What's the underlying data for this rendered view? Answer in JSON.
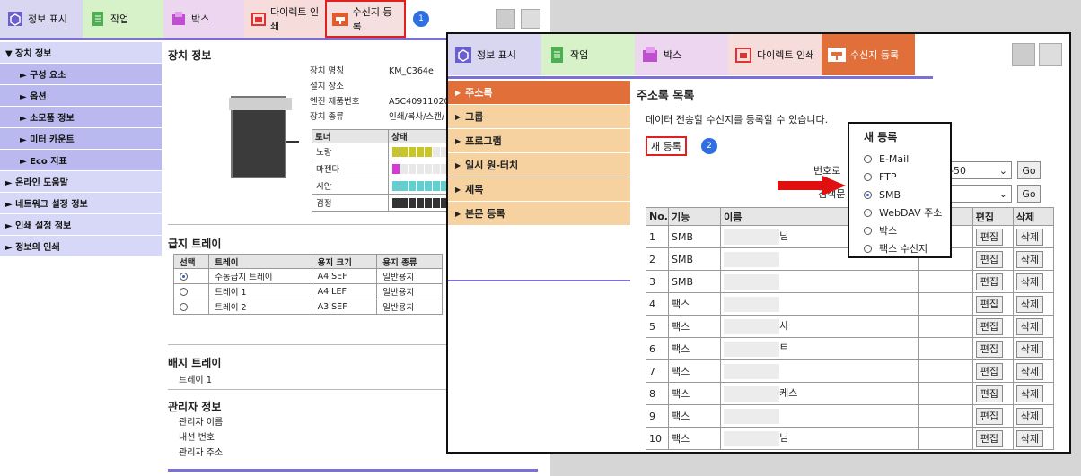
{
  "back": {
    "tabs": [
      "정보 표시",
      "작업",
      "박스",
      "다이렉트 인쇄",
      "수신지 등록"
    ],
    "badge": "1",
    "sidebar": [
      {
        "label": "▼ 장치 정보",
        "level": "top"
      },
      {
        "label": "► 구성 요소",
        "level": "sub"
      },
      {
        "label": "► 옵션",
        "level": "sub"
      },
      {
        "label": "► 소모품 정보",
        "level": "sub"
      },
      {
        "label": "► 미터 카운트",
        "level": "sub"
      },
      {
        "label": "► Eco 지표",
        "level": "sub"
      },
      {
        "label": "► 온라인 도움말",
        "level": "top"
      },
      {
        "label": "► 네트워크 설정 정보",
        "level": "top"
      },
      {
        "label": "► 인쇄 설정 정보",
        "level": "top"
      },
      {
        "label": "► 정보의 인쇄",
        "level": "top"
      }
    ],
    "device_title": "장치 정보",
    "device_info": [
      {
        "k": "장치 명칭",
        "v": "KM_C364e"
      },
      {
        "k": "설치 장소",
        "v": ""
      },
      {
        "k": "엔진 제품번호",
        "v": "A5C4091102013"
      },
      {
        "k": "장치 종류",
        "v": "인쇄/복사/스캔/"
      }
    ],
    "toner": {
      "headers": [
        "토너",
        "상태"
      ],
      "rows": [
        {
          "name": "노랑",
          "color": "#c9c42a",
          "segs": 5
        },
        {
          "name": "마젠다",
          "color": "#d63ad6",
          "segs": 1
        },
        {
          "name": "시안",
          "color": "#5fcfd2",
          "segs": 7
        },
        {
          "name": "검정",
          "color": "#333333",
          "segs": 7
        }
      ]
    },
    "feed_title": "급지 트레이",
    "feed_headers": [
      "선택",
      "트레이",
      "용지 크기",
      "용지 종류"
    ],
    "feed_rows": [
      {
        "selected": true,
        "tray": "수동급지 트레이",
        "size": "A4 SEF",
        "type": "일반용지"
      },
      {
        "selected": false,
        "tray": "트레이 1",
        "size": "A4 LEF",
        "type": "일반용지"
      },
      {
        "selected": false,
        "tray": "트레이 2",
        "size": "A3 SEF",
        "type": "일반용지"
      }
    ],
    "out_title": "배지 트레이",
    "out_item": "트레이 1",
    "admin_title": "관리자 정보",
    "admin_items": [
      "관리자 이름",
      "내선 번호",
      "관리자 주소"
    ]
  },
  "front": {
    "tabs": [
      "정보 표시",
      "작업",
      "박스",
      "다이렉트 인쇄",
      "수신지 등록"
    ],
    "sidebar": [
      "주소록",
      "그룹",
      "프로그램",
      "일시 원-터치",
      "제목",
      "본문 등록"
    ],
    "title": "주소록 목록",
    "desc": "데이터 전송할 수신지를 등록할 수 있습니다.",
    "new_btn": "새 등록",
    "badge": "2",
    "num_label": "번호로",
    "num_select": "-50",
    "search_label": "검색문",
    "go": "Go",
    "headers": [
      "No.",
      "기능",
      "이름",
      "E",
      "편집",
      "삭제"
    ],
    "rows": [
      {
        "no": "1",
        "type": "SMB",
        "name_tail": "님"
      },
      {
        "no": "2",
        "type": "SMB",
        "name_tail": ""
      },
      {
        "no": "3",
        "type": "SMB",
        "name_tail": ""
      },
      {
        "no": "4",
        "type": "팩스",
        "name_tail": ""
      },
      {
        "no": "5",
        "type": "팩스",
        "name_tail": "사"
      },
      {
        "no": "6",
        "type": "팩스",
        "name_tail": "트"
      },
      {
        "no": "7",
        "type": "팩스",
        "name_tail": ""
      },
      {
        "no": "8",
        "type": "팩스",
        "name_tail": "케스"
      },
      {
        "no": "9",
        "type": "팩스",
        "name_tail": ""
      },
      {
        "no": "10",
        "type": "팩스",
        "name_tail": "님"
      }
    ],
    "edit": "편집",
    "del": "삭제",
    "popup": {
      "title": "새 등록",
      "options": [
        {
          "label": "E-Mail",
          "selected": false
        },
        {
          "label": "FTP",
          "selected": false
        },
        {
          "label": "SMB",
          "selected": true
        },
        {
          "label": "WebDAV 주소",
          "selected": false
        },
        {
          "label": "박스",
          "selected": false
        },
        {
          "label": "팩스 수신지",
          "selected": false
        }
      ]
    }
  }
}
